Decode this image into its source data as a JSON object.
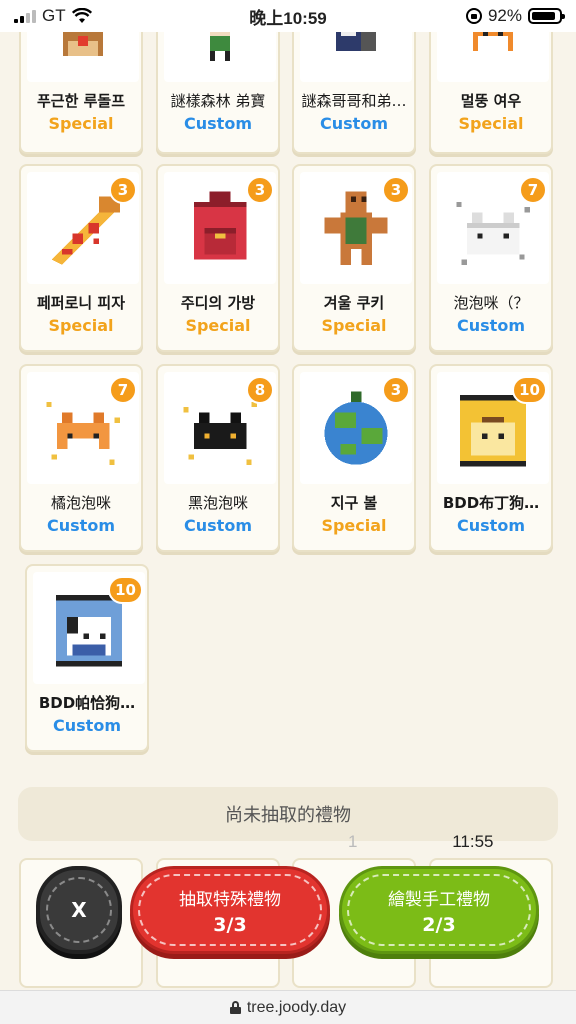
{
  "status_bar": {
    "carrier": "GT",
    "time": "晚上10:59",
    "battery_percent": "92%",
    "battery_level": 0.92
  },
  "partial_top_row": [
    {
      "name": "푸근한 루돌프",
      "type": "Special",
      "icon": "reindeer-icon"
    },
    {
      "name": "謎樣森林 弟寶",
      "type": "Custom",
      "icon": "forest-boy-icon"
    },
    {
      "name": "謎森哥哥和弟…",
      "type": "Custom",
      "icon": "brothers-icon"
    },
    {
      "name": "멀뚱 여우",
      "type": "Special",
      "icon": "fox-icon"
    }
  ],
  "gifts": [
    {
      "name": "페퍼로니 피자",
      "type": "Special",
      "count": "3",
      "icon": "pizza-icon"
    },
    {
      "name": "주디의 가방",
      "type": "Special",
      "count": "3",
      "icon": "backpack-icon"
    },
    {
      "name": "겨울 쿠키",
      "type": "Special",
      "count": "3",
      "icon": "gingerbread-icon"
    },
    {
      "name": "泡泡咪（？",
      "type": "Custom",
      "count": "7",
      "icon": "white-cat-icon"
    },
    {
      "name": "橘泡泡咪",
      "type": "Custom",
      "count": "7",
      "icon": "orange-cat-icon"
    },
    {
      "name": "黑泡泡咪",
      "type": "Custom",
      "count": "8",
      "icon": "black-cat-icon"
    },
    {
      "name": "지구 볼",
      "type": "Special",
      "count": "3",
      "icon": "earth-ornament-icon"
    },
    {
      "name": "BDD布丁狗…",
      "type": "Custom",
      "count": "10",
      "icon": "pompompurin-icon"
    },
    {
      "name": "BDD帕恰狗…",
      "type": "Custom",
      "count": "10",
      "icon": "pochacco-icon"
    }
  ],
  "pending_label": "尚未抽取的禮物",
  "overlay_time": "11:55",
  "overlay_ghost": "1",
  "actions": {
    "close_label": "X",
    "draw_special_label": "抽取特殊禮物",
    "draw_special_count": "3/3",
    "draw_custom_label": "繪製手工禮物",
    "draw_custom_count": "2/3"
  },
  "url": "tree.joody.day",
  "colors": {
    "special": "#f2a31c",
    "custom": "#2a8de6",
    "badge": "#f59c1a",
    "red_button": "#e2342f",
    "green_button": "#7cbc17"
  }
}
